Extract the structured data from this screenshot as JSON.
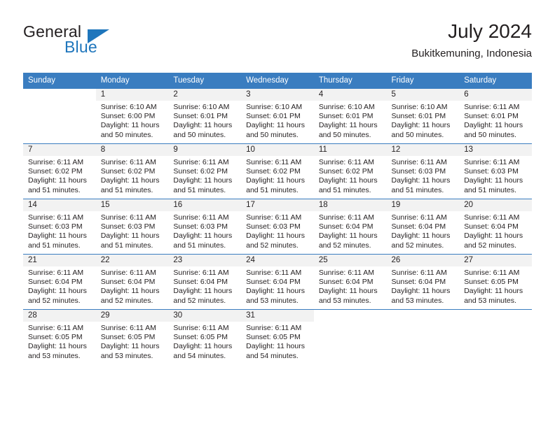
{
  "brand": {
    "word_one": "General",
    "word_two": "Blue",
    "accent_color": "#1f76bc",
    "triangle_icon": "brand-triangle-icon"
  },
  "header": {
    "title": "July 2024",
    "location": "Bukitkemuning, Indonesia"
  },
  "calendar": {
    "header_color": "#3a7dc0",
    "daynum_band_color": "#f2f2f2",
    "weekday_headers": [
      "Sunday",
      "Monday",
      "Tuesday",
      "Wednesday",
      "Thursday",
      "Friday",
      "Saturday"
    ],
    "weeks": [
      [
        {
          "day": "",
          "blank": true,
          "sunrise": "",
          "sunset": "",
          "daylight_line1": "",
          "daylight_line2": ""
        },
        {
          "day": "1",
          "sunrise": "Sunrise: 6:10 AM",
          "sunset": "Sunset: 6:00 PM",
          "daylight_line1": "Daylight: 11 hours",
          "daylight_line2": "and 50 minutes."
        },
        {
          "day": "2",
          "sunrise": "Sunrise: 6:10 AM",
          "sunset": "Sunset: 6:01 PM",
          "daylight_line1": "Daylight: 11 hours",
          "daylight_line2": "and 50 minutes."
        },
        {
          "day": "3",
          "sunrise": "Sunrise: 6:10 AM",
          "sunset": "Sunset: 6:01 PM",
          "daylight_line1": "Daylight: 11 hours",
          "daylight_line2": "and 50 minutes."
        },
        {
          "day": "4",
          "sunrise": "Sunrise: 6:10 AM",
          "sunset": "Sunset: 6:01 PM",
          "daylight_line1": "Daylight: 11 hours",
          "daylight_line2": "and 50 minutes."
        },
        {
          "day": "5",
          "sunrise": "Sunrise: 6:10 AM",
          "sunset": "Sunset: 6:01 PM",
          "daylight_line1": "Daylight: 11 hours",
          "daylight_line2": "and 50 minutes."
        },
        {
          "day": "6",
          "sunrise": "Sunrise: 6:11 AM",
          "sunset": "Sunset: 6:01 PM",
          "daylight_line1": "Daylight: 11 hours",
          "daylight_line2": "and 50 minutes."
        }
      ],
      [
        {
          "day": "7",
          "sunrise": "Sunrise: 6:11 AM",
          "sunset": "Sunset: 6:02 PM",
          "daylight_line1": "Daylight: 11 hours",
          "daylight_line2": "and 51 minutes."
        },
        {
          "day": "8",
          "sunrise": "Sunrise: 6:11 AM",
          "sunset": "Sunset: 6:02 PM",
          "daylight_line1": "Daylight: 11 hours",
          "daylight_line2": "and 51 minutes."
        },
        {
          "day": "9",
          "sunrise": "Sunrise: 6:11 AM",
          "sunset": "Sunset: 6:02 PM",
          "daylight_line1": "Daylight: 11 hours",
          "daylight_line2": "and 51 minutes."
        },
        {
          "day": "10",
          "sunrise": "Sunrise: 6:11 AM",
          "sunset": "Sunset: 6:02 PM",
          "daylight_line1": "Daylight: 11 hours",
          "daylight_line2": "and 51 minutes."
        },
        {
          "day": "11",
          "sunrise": "Sunrise: 6:11 AM",
          "sunset": "Sunset: 6:02 PM",
          "daylight_line1": "Daylight: 11 hours",
          "daylight_line2": "and 51 minutes."
        },
        {
          "day": "12",
          "sunrise": "Sunrise: 6:11 AM",
          "sunset": "Sunset: 6:03 PM",
          "daylight_line1": "Daylight: 11 hours",
          "daylight_line2": "and 51 minutes."
        },
        {
          "day": "13",
          "sunrise": "Sunrise: 6:11 AM",
          "sunset": "Sunset: 6:03 PM",
          "daylight_line1": "Daylight: 11 hours",
          "daylight_line2": "and 51 minutes."
        }
      ],
      [
        {
          "day": "14",
          "sunrise": "Sunrise: 6:11 AM",
          "sunset": "Sunset: 6:03 PM",
          "daylight_line1": "Daylight: 11 hours",
          "daylight_line2": "and 51 minutes."
        },
        {
          "day": "15",
          "sunrise": "Sunrise: 6:11 AM",
          "sunset": "Sunset: 6:03 PM",
          "daylight_line1": "Daylight: 11 hours",
          "daylight_line2": "and 51 minutes."
        },
        {
          "day": "16",
          "sunrise": "Sunrise: 6:11 AM",
          "sunset": "Sunset: 6:03 PM",
          "daylight_line1": "Daylight: 11 hours",
          "daylight_line2": "and 51 minutes."
        },
        {
          "day": "17",
          "sunrise": "Sunrise: 6:11 AM",
          "sunset": "Sunset: 6:03 PM",
          "daylight_line1": "Daylight: 11 hours",
          "daylight_line2": "and 52 minutes."
        },
        {
          "day": "18",
          "sunrise": "Sunrise: 6:11 AM",
          "sunset": "Sunset: 6:04 PM",
          "daylight_line1": "Daylight: 11 hours",
          "daylight_line2": "and 52 minutes."
        },
        {
          "day": "19",
          "sunrise": "Sunrise: 6:11 AM",
          "sunset": "Sunset: 6:04 PM",
          "daylight_line1": "Daylight: 11 hours",
          "daylight_line2": "and 52 minutes."
        },
        {
          "day": "20",
          "sunrise": "Sunrise: 6:11 AM",
          "sunset": "Sunset: 6:04 PM",
          "daylight_line1": "Daylight: 11 hours",
          "daylight_line2": "and 52 minutes."
        }
      ],
      [
        {
          "day": "21",
          "sunrise": "Sunrise: 6:11 AM",
          "sunset": "Sunset: 6:04 PM",
          "daylight_line1": "Daylight: 11 hours",
          "daylight_line2": "and 52 minutes."
        },
        {
          "day": "22",
          "sunrise": "Sunrise: 6:11 AM",
          "sunset": "Sunset: 6:04 PM",
          "daylight_line1": "Daylight: 11 hours",
          "daylight_line2": "and 52 minutes."
        },
        {
          "day": "23",
          "sunrise": "Sunrise: 6:11 AM",
          "sunset": "Sunset: 6:04 PM",
          "daylight_line1": "Daylight: 11 hours",
          "daylight_line2": "and 52 minutes."
        },
        {
          "day": "24",
          "sunrise": "Sunrise: 6:11 AM",
          "sunset": "Sunset: 6:04 PM",
          "daylight_line1": "Daylight: 11 hours",
          "daylight_line2": "and 53 minutes."
        },
        {
          "day": "25",
          "sunrise": "Sunrise: 6:11 AM",
          "sunset": "Sunset: 6:04 PM",
          "daylight_line1": "Daylight: 11 hours",
          "daylight_line2": "and 53 minutes."
        },
        {
          "day": "26",
          "sunrise": "Sunrise: 6:11 AM",
          "sunset": "Sunset: 6:04 PM",
          "daylight_line1": "Daylight: 11 hours",
          "daylight_line2": "and 53 minutes."
        },
        {
          "day": "27",
          "sunrise": "Sunrise: 6:11 AM",
          "sunset": "Sunset: 6:05 PM",
          "daylight_line1": "Daylight: 11 hours",
          "daylight_line2": "and 53 minutes."
        }
      ],
      [
        {
          "day": "28",
          "sunrise": "Sunrise: 6:11 AM",
          "sunset": "Sunset: 6:05 PM",
          "daylight_line1": "Daylight: 11 hours",
          "daylight_line2": "and 53 minutes."
        },
        {
          "day": "29",
          "sunrise": "Sunrise: 6:11 AM",
          "sunset": "Sunset: 6:05 PM",
          "daylight_line1": "Daylight: 11 hours",
          "daylight_line2": "and 53 minutes."
        },
        {
          "day": "30",
          "sunrise": "Sunrise: 6:11 AM",
          "sunset": "Sunset: 6:05 PM",
          "daylight_line1": "Daylight: 11 hours",
          "daylight_line2": "and 54 minutes."
        },
        {
          "day": "31",
          "sunrise": "Sunrise: 6:11 AM",
          "sunset": "Sunset: 6:05 PM",
          "daylight_line1": "Daylight: 11 hours",
          "daylight_line2": "and 54 minutes."
        },
        {
          "day": "",
          "blank": true,
          "sunrise": "",
          "sunset": "",
          "daylight_line1": "",
          "daylight_line2": ""
        },
        {
          "day": "",
          "blank": true,
          "sunrise": "",
          "sunset": "",
          "daylight_line1": "",
          "daylight_line2": ""
        },
        {
          "day": "",
          "blank": true,
          "sunrise": "",
          "sunset": "",
          "daylight_line1": "",
          "daylight_line2": ""
        }
      ]
    ]
  }
}
